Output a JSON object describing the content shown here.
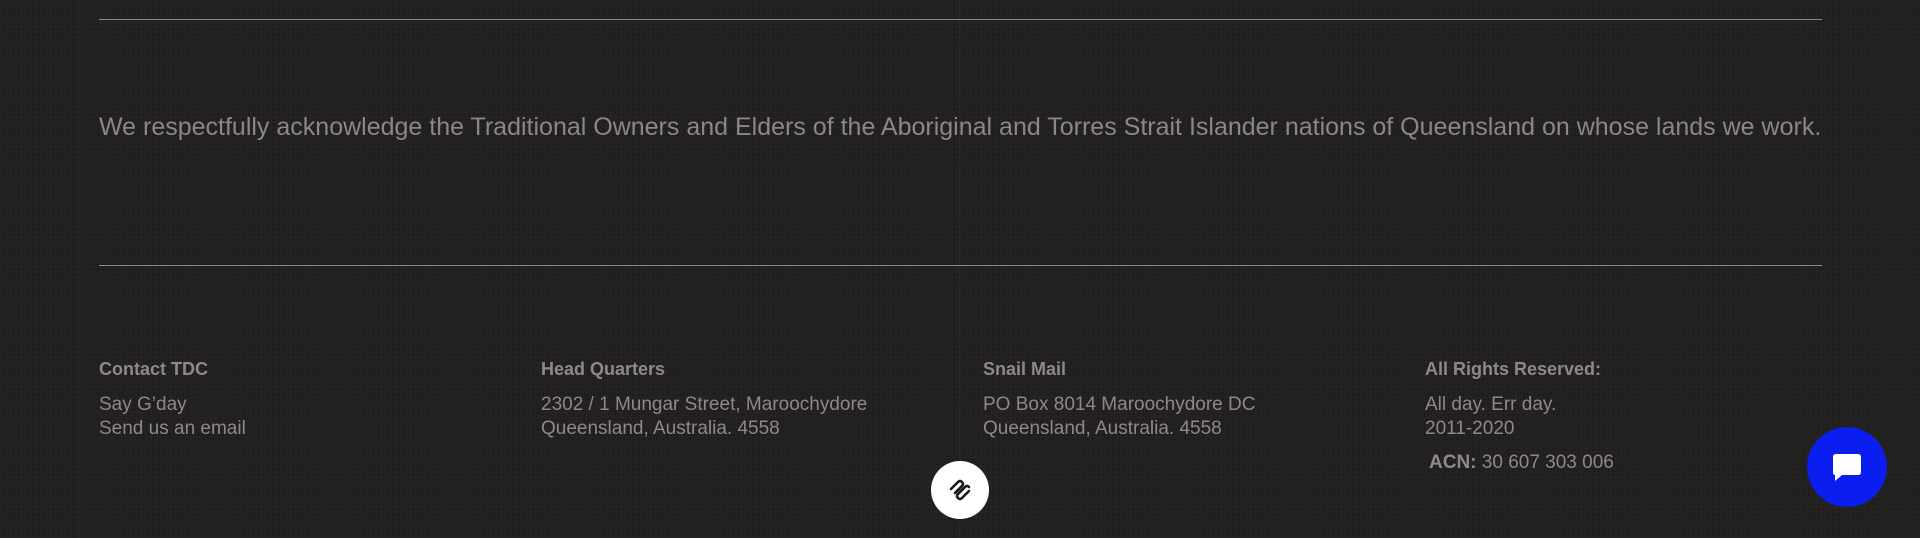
{
  "acknowledgement": {
    "text": "We respectfully acknowledge the Traditional Owners and Elders of the Aboriginal and Torres Strait Islander nations of Queensland on whose lands we work."
  },
  "footer": {
    "contact": {
      "heading": "Contact TDC",
      "say_gday": "Say G’day",
      "email_link": "Send us an email"
    },
    "headquarters": {
      "heading": "Head Quarters",
      "line1": "2302 / 1 Mungar Street, Maroochydore",
      "line2": "Queensland, Australia. 4558"
    },
    "snail_mail": {
      "heading": "Snail Mail",
      "line1": "PO Box 8014 Maroochydore DC",
      "line2": "Queensland, Australia. 4558"
    },
    "rights": {
      "heading": "All Rights Reserved:",
      "line1": "All day. Err day.",
      "line2": "2011-2020",
      "acn_label": "ACN:",
      "acn_value": " 30 607 303 006"
    }
  },
  "icons": {
    "squarespace_badge": "squarespace-logo-icon",
    "chat": "chat-bubble-icon"
  },
  "colors": {
    "background": "#221f1f",
    "text": "#8d8987",
    "divider": "#8c8a88",
    "chat_button": "#0a1ef0",
    "badge": "#ffffff"
  }
}
